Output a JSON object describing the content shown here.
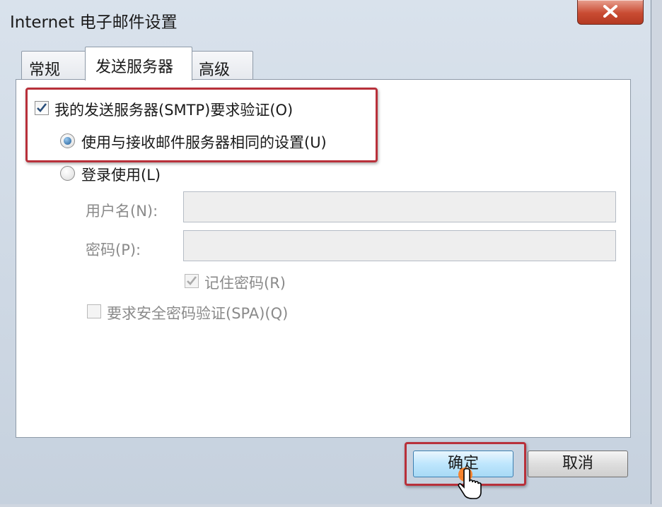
{
  "window": {
    "title": "Internet 电子邮件设置",
    "close_icon": "close-icon"
  },
  "tabs": [
    {
      "label": "常规",
      "selected": false
    },
    {
      "label": "发送服务器",
      "selected": true
    },
    {
      "label": "高级",
      "selected": false
    }
  ],
  "outgoing": {
    "require_auth_label": "我的发送服务器(SMTP)要求验证(O)",
    "require_auth_checked": true,
    "use_same_label": "使用与接收邮件服务器相同的设置(U)",
    "use_same_selected": true,
    "logon_label": "登录使用(L)",
    "logon_selected": false,
    "username_label": "用户名(N):",
    "username_value": "",
    "password_label": "密码(P):",
    "password_value": "",
    "remember_password_label": "记住密码(R)",
    "remember_password_checked": true,
    "spa_label": "要求安全密码验证(SPA)(Q)",
    "spa_checked": false
  },
  "buttons": {
    "ok_label": "确定",
    "cancel_label": "取消"
  },
  "annotation": {
    "highlight_color": "#b8303a",
    "cursor_icon": "hand-pointer-icon"
  }
}
